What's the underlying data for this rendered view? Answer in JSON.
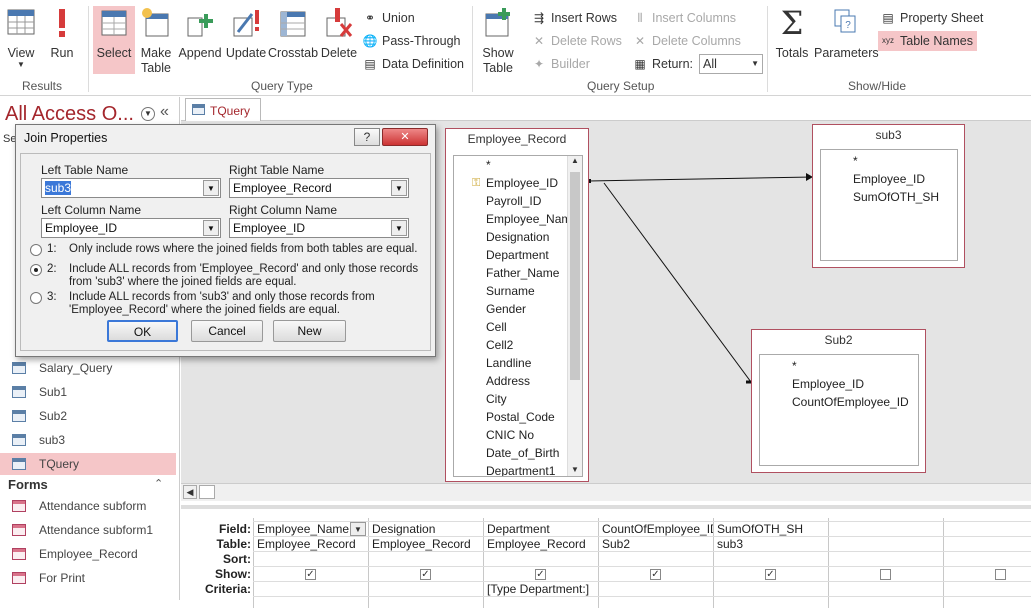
{
  "ribbon": {
    "results": {
      "view": "View",
      "run": "Run",
      "group": "Results"
    },
    "query_type": {
      "select": "Select",
      "make_table": "Make Table",
      "append": "Append",
      "update": "Update",
      "crosstab": "Crosstab",
      "delete": "Delete",
      "union": "Union",
      "pass_through": "Pass-Through",
      "data_definition": "Data Definition",
      "group": "Query Type"
    },
    "query_setup": {
      "show_table": "Show Table",
      "insert_rows": "Insert Rows",
      "delete_rows": "Delete Rows",
      "builder": "Builder",
      "insert_columns": "Insert Columns",
      "delete_columns": "Delete Columns",
      "return_label": "Return:",
      "return_value": "All",
      "group": "Query Setup"
    },
    "show_hide": {
      "totals": "Totals",
      "parameters": "Parameters",
      "property_sheet": "Property Sheet",
      "table_names": "Table Names",
      "group": "Show/Hide"
    }
  },
  "nav": {
    "title": "All Access O...",
    "search_stub": "Se",
    "queries": [
      "Salary_Query",
      "Sub1",
      "Sub2",
      "sub3",
      "TQuery"
    ],
    "forms_header": "Forms",
    "forms": [
      "Attendance subform",
      "Attendance subform1",
      "Employee_Record",
      "For Print"
    ]
  },
  "tab": {
    "label": "TQuery"
  },
  "tables": {
    "employee_record": {
      "title": "Employee_Record",
      "fields": [
        "*",
        "Employee_ID",
        "Payroll_ID",
        "Employee_Name",
        "Designation",
        "Department",
        "Father_Name",
        "Surname",
        "Gender",
        "Cell",
        "Cell2",
        "Landline",
        "Address",
        "City",
        "Postal_Code",
        "CNIC No",
        "Date_of_Birth",
        "Department1"
      ]
    },
    "sub3": {
      "title": "sub3",
      "fields": [
        "*",
        "Employee_ID",
        "SumOfOTH_SH"
      ]
    },
    "sub2": {
      "title": "Sub2",
      "fields": [
        "*",
        "Employee_ID",
        "CountOfEmployee_ID"
      ]
    }
  },
  "grid": {
    "row_labels": {
      "field": "Field:",
      "table": "Table:",
      "sort": "Sort:",
      "show": "Show:",
      "criteria": "Criteria:"
    },
    "columns": [
      {
        "field": "Employee_Name",
        "table": "Employee_Record",
        "show": true,
        "criteria": ""
      },
      {
        "field": "Designation",
        "table": "Employee_Record",
        "show": true,
        "criteria": ""
      },
      {
        "field": "Department",
        "table": "Employee_Record",
        "show": true,
        "criteria": "[Type Department:]"
      },
      {
        "field": "CountOfEmployee_ID",
        "table": "Sub2",
        "show": true,
        "criteria": ""
      },
      {
        "field": "SumOfOTH_SH",
        "table": "sub3",
        "show": true,
        "criteria": ""
      },
      {
        "field": "",
        "table": "",
        "show": false,
        "criteria": ""
      },
      {
        "field": "",
        "table": "",
        "show": false,
        "criteria": ""
      }
    ]
  },
  "dialog": {
    "title": "Join Properties",
    "help": "?",
    "close": "✕",
    "left_table_label": "Left Table Name",
    "left_table_value": "sub3",
    "right_table_label": "Right Table Name",
    "right_table_value": "Employee_Record",
    "left_column_label": "Left Column Name",
    "left_column_value": "Employee_ID",
    "right_column_label": "Right Column Name",
    "right_column_value": "Employee_ID",
    "options": [
      {
        "num": "1:",
        "text": "Only include rows where the joined fields from both tables are equal."
      },
      {
        "num": "2:",
        "text": "Include ALL records from 'Employee_Record' and only those records from 'sub3' where the joined fields are equal."
      },
      {
        "num": "3:",
        "text": "Include ALL records from 'sub3' and only those records from 'Employee_Record' where the joined fields are equal."
      }
    ],
    "selected_option": 2,
    "ok": "OK",
    "cancel": "Cancel",
    "new": "New"
  }
}
